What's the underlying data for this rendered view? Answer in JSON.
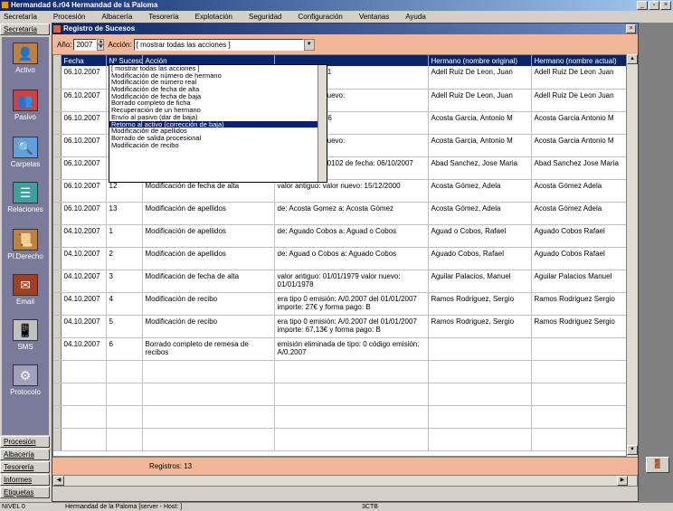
{
  "app": {
    "title": "Hermandad 6.r04  Hermandad de la Paloma"
  },
  "menu": [
    "Secretaría",
    "Procesión",
    "Albacería",
    "Tesorería",
    "Explotación",
    "Seguridad",
    "Configuración",
    "Ventanas",
    "Ayuda"
  ],
  "sidebar": {
    "top_tab": "Secretaría",
    "items": [
      {
        "label": "Activo",
        "icon": "person-active-icon",
        "glyph": "👤"
      },
      {
        "label": "Pasivo",
        "icon": "person-passive-icon",
        "glyph": "👥"
      },
      {
        "label": "Carpetas",
        "icon": "folder-search-icon",
        "glyph": "🔍"
      },
      {
        "label": "Relaciones",
        "icon": "relations-icon",
        "glyph": "☰"
      },
      {
        "label": "Pl.Derecho",
        "icon": "document-icon",
        "glyph": "📜"
      },
      {
        "label": "Email",
        "icon": "email-icon",
        "glyph": "✉"
      },
      {
        "label": "SMS",
        "icon": "phone-icon",
        "glyph": "📱"
      },
      {
        "label": "Protocolo",
        "icon": "protocol-icon",
        "glyph": "⚙"
      }
    ],
    "bottom_tabs": [
      "Procesión",
      "Albacería",
      "Tesorería",
      "Informes",
      "Etiquetas"
    ]
  },
  "window": {
    "title": "Registro de Sucesos"
  },
  "filter": {
    "year_label": "Año:",
    "year_value": "2007",
    "action_label": "Acción:",
    "action_value": "[ mostrar todas las acciones ]"
  },
  "dropdown": {
    "items": [
      "[ mostrar todas las acciones ]",
      "Modificación de número de hermano",
      "Modificación de número real",
      "Modificación de fecha de alta",
      "Modificación de fecha de baja",
      "Borrado completo de ficha",
      "Recuperación de un hermano",
      "Envío al pasivo (dar de baja)",
      "Retorno al activo (corrección de baja)",
      "Modificación de apellidos",
      "Borrado de salida procesional",
      "Modificación de recibo"
    ],
    "selected_index": 8
  },
  "table": {
    "headers": [
      "Fecha",
      "Nº Suceso",
      "Acción",
      "",
      "Hermano (nombre original)",
      "Hermano (nombre actual)"
    ],
    "rows": [
      {
        "fecha": "06.10.2007",
        "num": "7",
        "accion": "Modificación de número de hermano",
        "detalle": "1 y NºReal: 1101",
        "original": "Adell Ruiz De Leon, Juan",
        "actual": "Adell Ruiz De Leon Juan"
      },
      {
        "fecha": "06.10.2007",
        "num": "8",
        "accion": "Modificación de fecha de alta",
        "detalle": "07/2000 valor nuevo:",
        "original": "Adell Ruiz De Leon, Juan",
        "actual": "Adell Ruiz De Leon Juan"
      },
      {
        "fecha": "06.10.2007",
        "num": "9",
        "accion": "Modificación de número de hermano",
        "detalle": "5 y NºReal: 1986",
        "original": "Acosta Garcia, Antonio M",
        "actual": "Acosta Garcia Antonio M"
      },
      {
        "fecha": "06.10.2007",
        "num": "10",
        "accion": "Modificación de fecha de alta",
        "detalle": "06/2005 valor nuevo:",
        "original": "Acosta Garcia, Antonio M",
        "actual": "Acosta Garcia Antonio M"
      },
      {
        "fecha": "06.10.2007",
        "num": "11",
        "accion": "Modificación de donativos",
        "detalle": "era la cuenta 0/0102 de fecha: 06/10/2007 importe: 1230€",
        "original": "Abad Sanchez, Jose Maria",
        "actual": "Abad Sanchez Jose Maria"
      },
      {
        "fecha": "06.10.2007",
        "num": "12",
        "accion": "Modificación de fecha de alta",
        "detalle": "valor antiguo:  valor nuevo: 15/12/2000",
        "original": "Acosta Gómez, Adela",
        "actual": "Acosta Gómez Adela"
      },
      {
        "fecha": "06.10.2007",
        "num": "13",
        "accion": "Modificación de apellidos",
        "detalle": "de: Acosta Gomez a: Acosta Gómez",
        "original": "Acosta Gómez, Adela",
        "actual": "Acosta Gómez Adela"
      },
      {
        "fecha": "04.10.2007",
        "num": "1",
        "accion": "Modificación de apellidos",
        "detalle": "de: Aguado Cobos a: Aguad o Cobos",
        "original": "Aguad o Cobos, Rafael",
        "actual": "Aguado Cobos Rafael"
      },
      {
        "fecha": "04.10.2007",
        "num": "2",
        "accion": "Modificación de apellidos",
        "detalle": "de: Aguad o Cobos a: Aguado Cobos",
        "original": "Aguado Cobos, Rafael",
        "actual": "Aguado Cobos Rafael"
      },
      {
        "fecha": "04.10.2007",
        "num": "3",
        "accion": "Modificación de fecha de alta",
        "detalle": "valor antiguo: 01/01/1979 valor nuevo: 01/01/1978",
        "original": "Aguilar Palacios, Manuel",
        "actual": "Aguilar Palacios Manuel"
      },
      {
        "fecha": "04.10.2007",
        "num": "4",
        "accion": "Modificación de recibo",
        "detalle": "era tipo 0 emisión: A/0.2007 del 01/01/2007 importe: 27€ y forma pago: B",
        "original": "Ramos Rodriguez, Sergio",
        "actual": "Ramos Rodriguez Sergio"
      },
      {
        "fecha": "04.10.2007",
        "num": "5",
        "accion": "Modificación de recibo",
        "detalle": "era tipo 0 emisión: A/0.2007 del 01/01/2007 importe: 67,13€ y forma pago: B",
        "original": "Ramos Rodriguez, Sergio",
        "actual": "Ramos Rodriguez Sergio"
      },
      {
        "fecha": "04.10.2007",
        "num": "6",
        "accion": "Borrado completo de remesa de recibos",
        "detalle": "emisión eliminada de tipo: 0 código emisión: A/0.2007",
        "original": "",
        "actual": ""
      }
    ]
  },
  "footer": {
    "registros": "Registros: 13"
  },
  "statusbar": {
    "left": "NIVEL 0",
    "middle": "Hermandad de la Paloma [server - Host: ]",
    "right": "3CTB"
  },
  "colors": {
    "accent": "#0a246a",
    "filter_bg": "#f0b898",
    "sidebar_bg": "#7a7a9a"
  }
}
